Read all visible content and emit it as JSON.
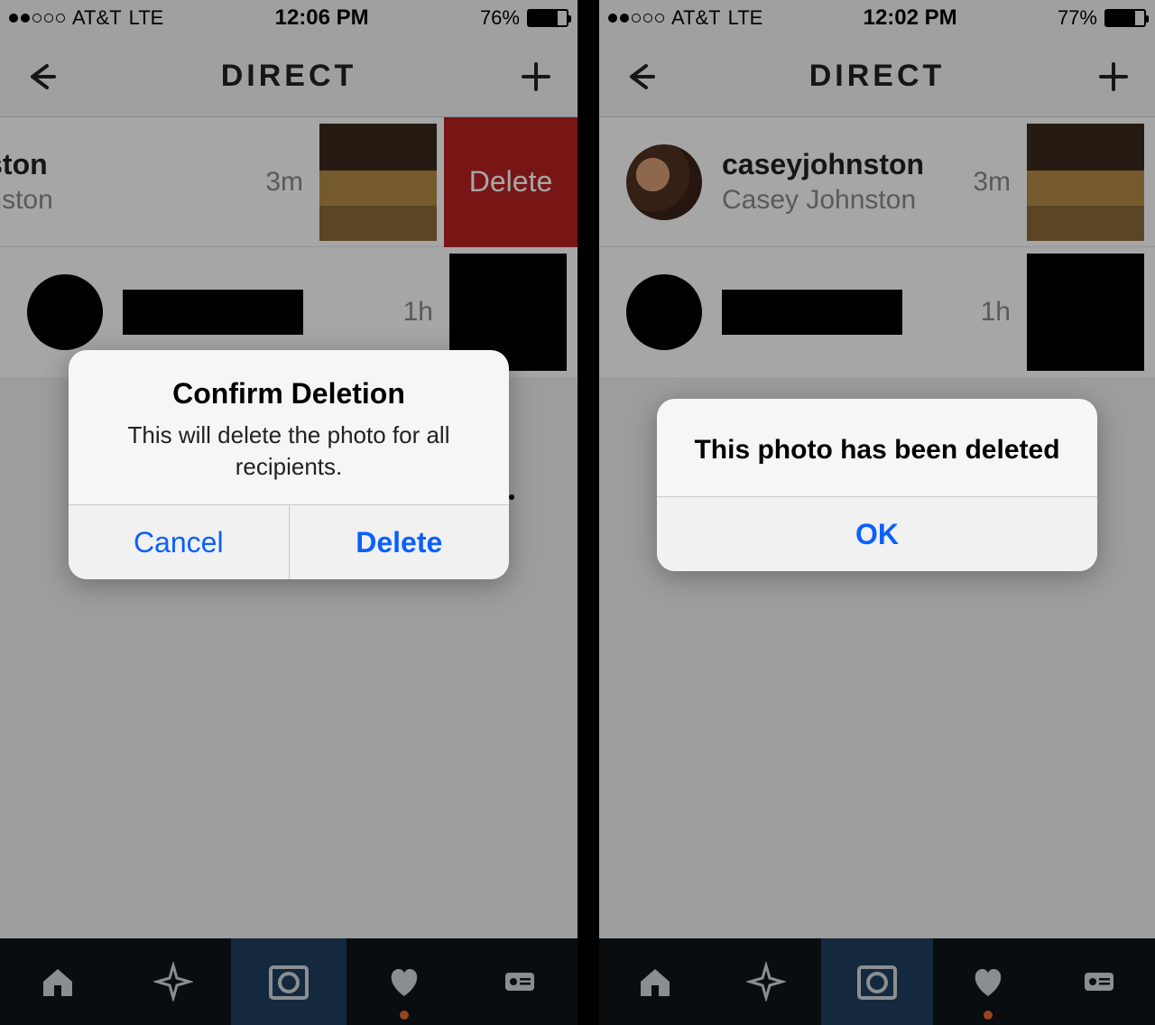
{
  "left": {
    "status": {
      "carrier": "AT&T",
      "net": "LTE",
      "time": "12:06 PM",
      "battery_pct": "76%",
      "battery_fill": 76
    },
    "header": {
      "title": "DIRECT"
    },
    "rows": [
      {
        "username": "eyjohnston",
        "realname": "sey Johnston",
        "time": "3m",
        "delete_label": "Delete"
      },
      {
        "time": "1h"
      }
    ],
    "dialog": {
      "title": "Confirm Deletion",
      "body": "This will delete the photo for all recipients.",
      "cancel": "Cancel",
      "confirm": "Delete"
    }
  },
  "right": {
    "status": {
      "carrier": "AT&T",
      "net": "LTE",
      "time": "12:02 PM",
      "battery_pct": "77%",
      "battery_fill": 77
    },
    "header": {
      "title": "DIRECT"
    },
    "rows": [
      {
        "username": "caseyjohnston",
        "realname": "Casey Johnston",
        "time": "3m"
      },
      {
        "time": "1h"
      }
    ],
    "dialog": {
      "message": "This photo has been deleted",
      "ok": "OK"
    }
  },
  "colors": {
    "delete_red": "#b92222",
    "ios_blue": "#0a60ff"
  }
}
